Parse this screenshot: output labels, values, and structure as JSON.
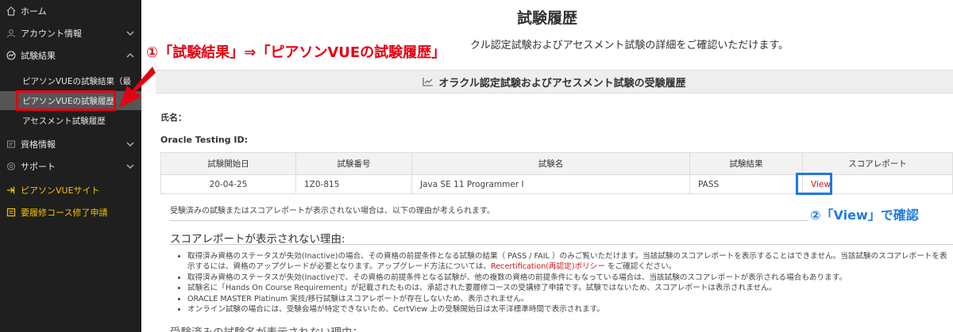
{
  "sidebar": {
    "items": [
      {
        "label": "ホーム",
        "icon": "home-icon"
      },
      {
        "label": "アカウント情報",
        "icon": "user-icon"
      },
      {
        "label": "試験結果",
        "icon": "results-icon"
      },
      {
        "label": "資格情報",
        "icon": "certificate-icon"
      },
      {
        "label": "サポート",
        "icon": "support-icon"
      },
      {
        "label": "ピアソンVUEサイト",
        "icon": "external-link-icon"
      },
      {
        "label": "要履修コース修了申請",
        "icon": "form-icon"
      }
    ],
    "sub_items": [
      {
        "label": "ピアソンVUEの試験結果（最"
      },
      {
        "label": "ピアソンVUEの試験履歴"
      },
      {
        "label": "アセスメント試験履歴"
      }
    ],
    "accent_color": "#f2c200"
  },
  "page": {
    "title": "試験履歴",
    "subtitle": "クル認定試験およびアセスメント試験の詳細をご確認いただけます。",
    "panel_title": "オラクル認定試験およびアセスメント試験の受験履歴",
    "name_label": "氏名：",
    "testing_id_label": "Oracle Testing ID:"
  },
  "table": {
    "headers": [
      "試験開始日",
      "試験番号",
      "試験名",
      "試験結果",
      "スコアレポート"
    ],
    "rows": [
      {
        "date": "20-04-25",
        "number": "1Z0-815",
        "name": "Java SE 11 Programmer I",
        "result": "PASS",
        "report": "View"
      }
    ]
  },
  "note": {
    "prefix": "受験済みの試験またはスコアレポートが表示されない場合は、以下の理由が考えられます。"
  },
  "reasons": {
    "title": "スコアレポートが表示されない理由:",
    "items": [
      "取得済み資格のステータスが失効(Inactive)の場合、その資格の前提条件となる試験の結果（ PASS / FAIL ）のみご覧いただけます。当該試験のスコアレポートを表示することはできません。当該試験のスコアレポートを表示するには、資格のアップグレードが必要となります。アップグレード方法については、",
      "取得済み資格のステータスが失効(Inactive)で、その資格の前提条件となる試験が、他の複数の資格の前提条件にもなっている場合は、当該試験のスコアレポートが表示される場合もあります。",
      "試験名に「Hands On Course Requirement」が記載されたものは、承認された要履修コースの受講修了申請です。試験ではないため、スコアレポートは表示されません。",
      "ORACLE MASTER Platinum 実技/移行試験はスコアレポートが存在しないため、表示されません。",
      "オンライン試験の場合には、受験会場が特定できないため、CertView 上の受験開始日は太平洋標準時間で表示されます。"
    ],
    "link_text": "Recertification(再認定)ポリシー",
    "item0_suffix": " をご確認ください。",
    "cut_title": "受験済みの試験名が表示されない理由："
  },
  "annotations": {
    "step1": "①「試験結果」⇒「ピアソンVUEの試験履歴」",
    "step2": "②「View」で確認",
    "step1_color": "#e60012",
    "step2_color": "#1f7ae0"
  }
}
